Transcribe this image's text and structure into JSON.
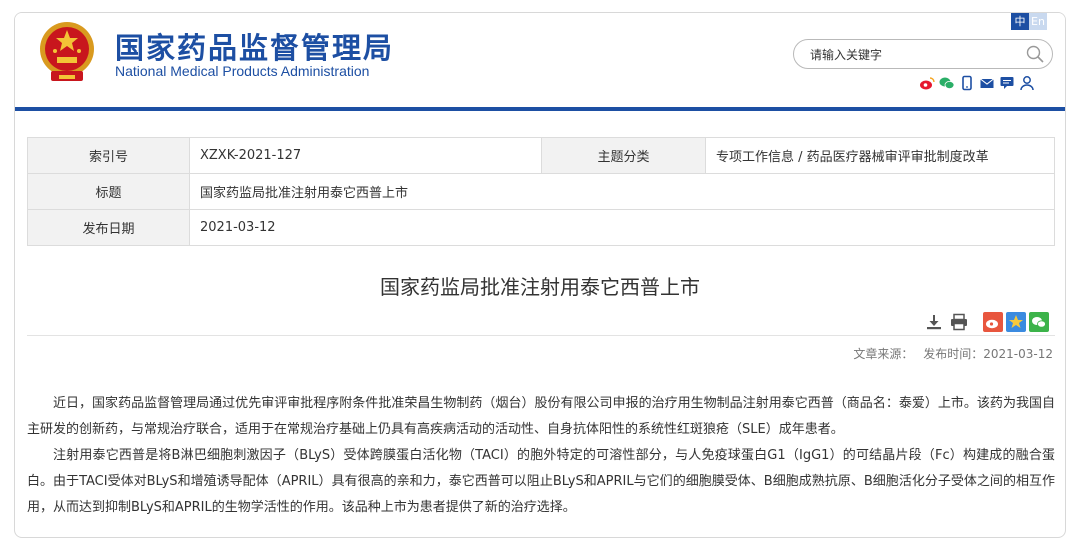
{
  "header": {
    "site_title_cn": "国家药品监督管理局",
    "site_title_en": "National Medical Products Administration",
    "lang_zh": "中",
    "lang_en": "En",
    "search_placeholder": "请输入关键字",
    "brand_color": "#1d4fa3",
    "social_icons": [
      "weibo-icon",
      "wechat-icon",
      "mobile-icon",
      "mail-icon",
      "message-icon",
      "user-icon"
    ]
  },
  "info": {
    "index_label": "索引号",
    "index_value": "XZXK-2021-127",
    "topic_label": "主题分类",
    "topic_value": "专项工作信息 / 药品医疗器械审评审批制度改革",
    "title_label": "标题",
    "title_value": "国家药监局批准注射用泰它西普上市",
    "date_label": "发布日期",
    "date_value": "2021-03-12"
  },
  "article": {
    "title": "国家药监局批准注射用泰它西普上市",
    "source": "文章来源：",
    "publish_time": "发布时间：2021-03-12",
    "paragraphs": [
      "近日，国家药品监督管理局通过优先审评审批程序附条件批准荣昌生物制药（烟台）股份有限公司申报的治疗用生物制品注射用泰它西普（商品名：泰爱）上市。该药为我国自主研发的创新药，与常规治疗联合，适用于在常规治疗基础上仍具有高疾病活动的活动性、自身抗体阳性的系统性红斑狼疮（SLE）成年患者。",
      "注射用泰它西普是将B淋巴细胞刺激因子（BLyS）受体跨膜蛋白活化物（TACI）的胞外特定的可溶性部分，与人免疫球蛋白G1（IgG1）的可结晶片段（Fc）构建成的融合蛋白。由于TACI受体对BLyS和增殖诱导配体（APRIL）具有很高的亲和力，泰它西普可以阻止BLyS和APRIL与它们的细胞膜受体、B细胞成熟抗原、B细胞活化分子受体之间的相互作用，从而达到抑制BLyS和APRIL的生物学活性的作用。该品种上市为患者提供了新的治疗选择。"
    ]
  },
  "toolbar": {
    "icons": [
      "download-icon",
      "print-icon"
    ],
    "share_icons": [
      "weibo-share-icon",
      "qzone-share-icon",
      "wechat-share-icon"
    ]
  }
}
